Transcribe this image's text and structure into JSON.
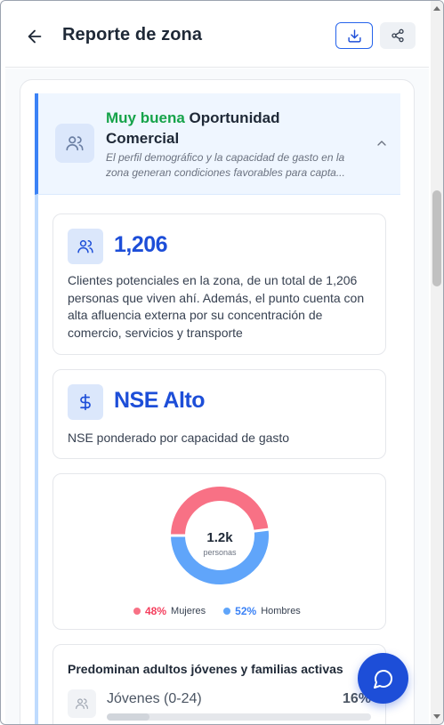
{
  "header": {
    "title": "Reporte de zona"
  },
  "banner": {
    "rating": "Muy buena",
    "title_rest": "Oportunidad Comercial",
    "description": "El perfil demográfico y la capacidad de gasto en la zona generan condiciones favorables para capta..."
  },
  "clients_card": {
    "value": "1,206",
    "description": "Clientes potenciales en la zona, de un total de 1,206 personas que viven ahí. Además, el punto cuenta con alta afluencia externa por su concentración de comercio, servicios y transporte"
  },
  "nse_card": {
    "value": "NSE Alto",
    "description": "NSE ponderado por capacidad de gasto"
  },
  "chart_data": {
    "type": "pie",
    "center_value": "1.2k",
    "center_label": "personas",
    "slices": [
      {
        "name": "Mujeres",
        "pct_label": "48%",
        "value": 48,
        "color": "#f87185"
      },
      {
        "name": "Hombres",
        "pct_label": "52%",
        "value": 52,
        "color": "#60a5fa"
      }
    ]
  },
  "segment_card": {
    "title": "Predominan adultos jóvenes y familias activas",
    "items": [
      {
        "label": "Jóvenes (0-24)",
        "pct": "16%",
        "value": 0.16
      }
    ]
  },
  "colors": {
    "accent": "#1d4ed8",
    "good": "#16a34a"
  }
}
